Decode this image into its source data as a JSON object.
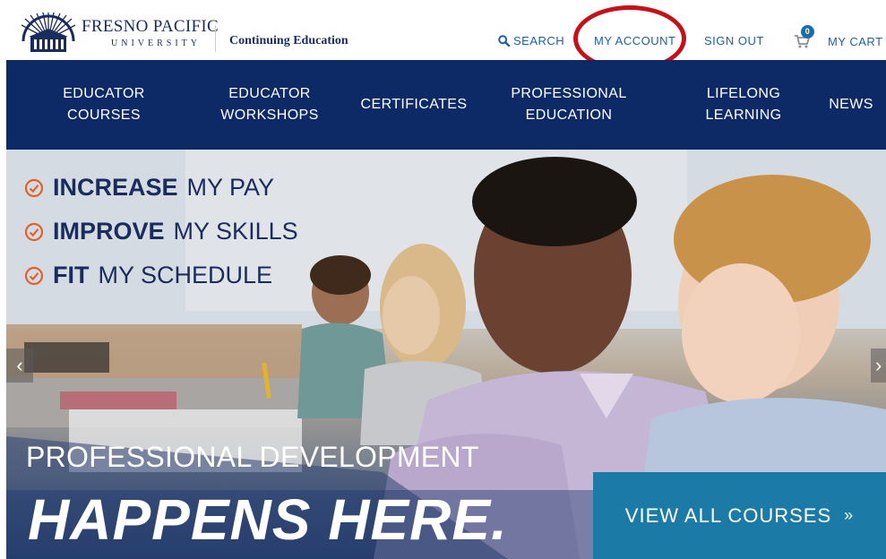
{
  "header": {
    "logo_name": "FRESNO PACIFIC",
    "logo_sub": "UNIVERSITY",
    "section_label": "Continuing Education",
    "search_label": "SEARCH",
    "account_label": "MY ACCOUNT",
    "signout_label": "SIGN OUT",
    "cart_label": "MY CART",
    "cart_count": "0"
  },
  "nav": {
    "items": [
      {
        "label": "EDUCATOR\nCOURSES"
      },
      {
        "label": "EDUCATOR\nWORKSHOPS"
      },
      {
        "label": "CERTIFICATES"
      },
      {
        "label": "PROFESSIONAL\nEDUCATION"
      },
      {
        "label": "LIFELONG\nLEARNING"
      },
      {
        "label": "NEWS"
      }
    ]
  },
  "hero": {
    "bullets": [
      {
        "bold": "INCREASE",
        "rest": "MY PAY"
      },
      {
        "bold": "IMPROVE",
        "rest": "MY SKILLS"
      },
      {
        "bold": "FIT",
        "rest": "MY SCHEDULE"
      }
    ],
    "headline_small": "PROFESSIONAL DEVELOPMENT",
    "headline_large": "HAPPENS HERE.",
    "cta_label": "VIEW ALL COURSES",
    "cta_arrows": "»",
    "prev_arrow": "‹",
    "next_arrow": "›"
  },
  "colors": {
    "nav_bg": "#0e2a66",
    "link_blue": "#1f5fa6",
    "accent_orange": "#e0622a",
    "cta_bg": "#1b7ba6",
    "highlight_red": "#c4121a"
  }
}
